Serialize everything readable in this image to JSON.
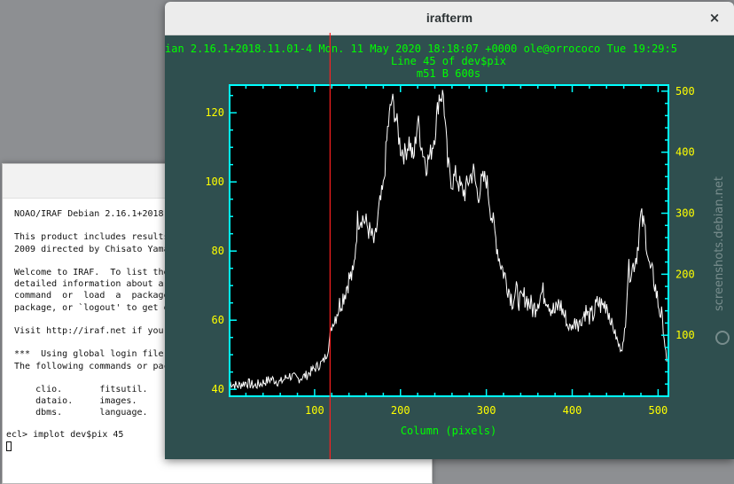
{
  "xterm": {
    "lines": [
      "NOAO/IRAF Debian 2.16.1+2018.",
      "",
      "This product includes results",
      "2009 directed by Chisato Yama",
      "",
      "Welcome to IRAF.  To list the",
      "detailed information about a",
      "command  or  load  a  package",
      "package, or `logout' to get o",
      "",
      "Visit http://iraf.net if you",
      "",
      "***  Using global login file:",
      "The following commands or pac",
      "",
      "    clio.       fitsutil.    l",
      "    dataio.     images.      n",
      "    dbms.       language.    o"
    ],
    "prompt": "ecl> implot dev$pix 45"
  },
  "window": {
    "title": "irafterm",
    "close_glyph": "×"
  },
  "plot": {
    "header_line": "ian 2.16.1+2018.11.01-4 Mon. 11 May 2020 18:18:07 +0000 ole@orrococo Tue 19:29:5",
    "title_line2": "Line 45 of dev$pix",
    "title_line3": "m51  B  600s"
  },
  "watermark": "screenshots.debian.net",
  "colors": {
    "plot_bg": "#2f4f4f",
    "axes": "#00ffff",
    "labels_green": "#00ff00",
    "ticks_yellow": "#ffff00",
    "curve": "#ffffff",
    "cursor_line": "#ff2020"
  },
  "chart_data": {
    "type": "line",
    "title": "Line 45 of dev$pix",
    "subtitle": "m51  B  600s",
    "xlabel": "Column (pixels)",
    "ylabel": "",
    "xlim": [
      1,
      512
    ],
    "ylim": [
      38,
      128
    ],
    "y2lim": [
      0,
      510
    ],
    "x_ticks": [
      100,
      200,
      300,
      400,
      500
    ],
    "y_ticks": [
      40,
      60,
      80,
      100,
      120
    ],
    "y2_ticks": [
      100,
      200,
      300,
      400,
      500
    ],
    "cursor_x": 118,
    "series": [
      {
        "x": [
          1,
          10,
          20,
          30,
          40,
          50,
          60,
          70,
          80,
          90,
          100,
          105,
          110,
          115,
          120,
          125,
          130,
          135,
          140,
          145,
          150,
          155,
          160,
          165,
          170,
          175,
          180,
          185,
          190,
          195,
          200,
          205,
          210,
          215,
          220,
          225,
          230,
          235,
          240,
          245,
          250,
          255,
          260,
          265,
          270,
          275,
          280,
          285,
          290,
          295,
          300,
          305,
          310,
          315,
          320,
          325,
          330,
          335,
          340,
          345,
          350,
          355,
          360,
          365,
          370,
          375,
          380,
          385,
          390,
          395,
          400,
          405,
          410,
          415,
          420,
          425,
          430,
          435,
          440,
          445,
          450,
          455,
          460,
          465,
          470,
          475,
          480,
          485,
          490,
          495,
          500,
          505,
          510
        ],
        "y": [
          42,
          41,
          42,
          41,
          42,
          43,
          42,
          44,
          43,
          44,
          46,
          47,
          48,
          51,
          58,
          62,
          65,
          68,
          72,
          73,
          89,
          90,
          88,
          85,
          82,
          92,
          98,
          115,
          124,
          118,
          110,
          108,
          112,
          106,
          118,
          110,
          105,
          108,
          114,
          125,
          125,
          105,
          100,
          102,
          98,
          97,
          101,
          103,
          96,
          100,
          101,
          92,
          85,
          78,
          74,
          70,
          66,
          68,
          65,
          67,
          65,
          63,
          66,
          68,
          67,
          64,
          62,
          65,
          62,
          58,
          58,
          61,
          59,
          63,
          60,
          62,
          65,
          64,
          65,
          60,
          56,
          52,
          53,
          74,
          75,
          79,
          90,
          86,
          75,
          72,
          65,
          60,
          48
        ]
      }
    ]
  }
}
